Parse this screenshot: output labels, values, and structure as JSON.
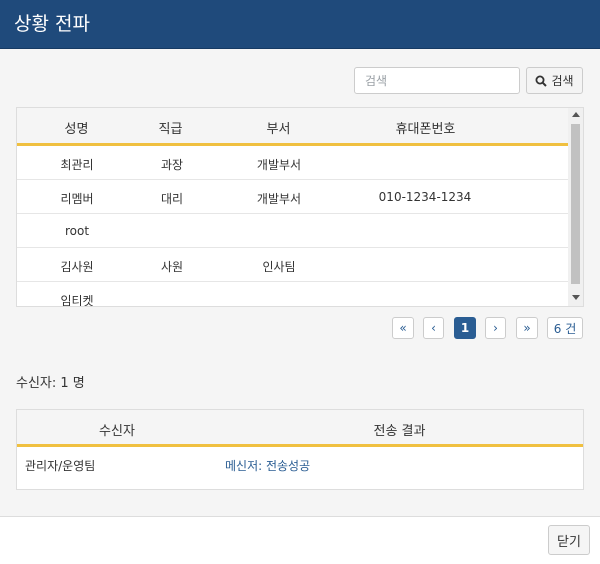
{
  "dialog": {
    "title": "상황 전파"
  },
  "search": {
    "placeholder": "검색",
    "button_label": "검색"
  },
  "users_table": {
    "headers": [
      "성명",
      "직급",
      "부서",
      "휴대폰번호"
    ],
    "rows": [
      [
        "최관리",
        "과장",
        "개발부서",
        ""
      ],
      [
        "리멤버",
        "대리",
        "개발부서",
        "010-1234-1234"
      ],
      [
        "root",
        "",
        "",
        ""
      ],
      [
        "김사원",
        "사원",
        "인사팀",
        ""
      ],
      [
        "임티켓",
        "",
        "",
        ""
      ]
    ]
  },
  "pagination": {
    "first": "«",
    "prev": "‹",
    "current": "1",
    "next": "›",
    "last": "»",
    "total": "6 건"
  },
  "recipients": {
    "count_label": "수신자: 1 명"
  },
  "result_table": {
    "headers": [
      "수신자",
      "전송 결과"
    ],
    "rows": [
      [
        "관리자/운영팀",
        "메신저: 전송성공"
      ]
    ]
  },
  "footer": {
    "close_label": "닫기"
  },
  "colors": {
    "header_bg": "#1f4a7b",
    "accent_line": "#f0c040",
    "link": "#2a5d93"
  },
  "icons": {
    "search": "search-icon"
  }
}
